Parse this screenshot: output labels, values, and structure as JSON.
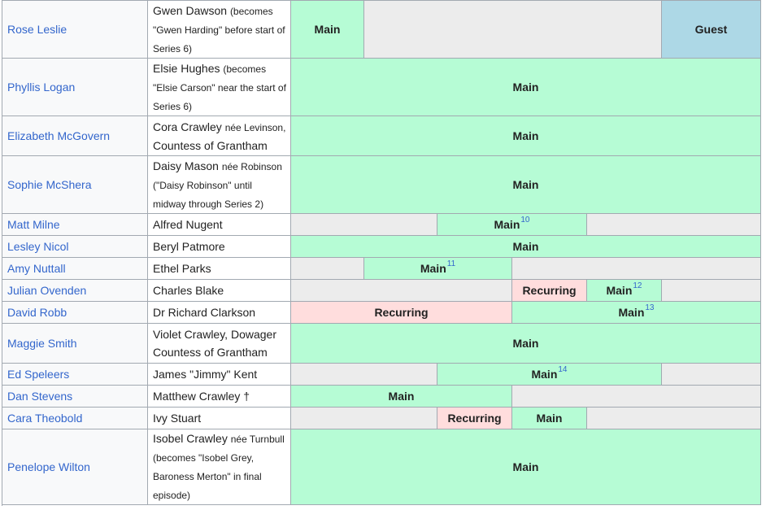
{
  "rows": [
    {
      "actor": "Rose Leslie",
      "role": "Gwen Dawson",
      "role_note": "(becomes \"Gwen Harding\" before start of Series 6)",
      "segs": [
        {
          "t": "main",
          "label": "Main"
        },
        {
          "t": "none",
          "label": ""
        },
        {
          "t": "guest",
          "label": "Guest"
        }
      ]
    },
    {
      "actor": "Phyllis Logan",
      "role": "Elsie Hughes",
      "role_note": "(becomes \"Elsie Carson\" near the start of Series 6)",
      "segs": [
        {
          "t": "main",
          "label": "Main"
        }
      ]
    },
    {
      "actor": "Elizabeth McGovern",
      "role": "Cora Crawley",
      "role_note": "née Levinson,",
      "role_tail": "Countess of Grantham",
      "segs": [
        {
          "t": "main",
          "label": "Main"
        }
      ]
    },
    {
      "actor": "Sophie McShera",
      "role": "Daisy Mason",
      "role_note": "née Robinson (\"Daisy Robinson\" until midway through Series 2)",
      "segs": [
        {
          "t": "main",
          "label": "Main"
        }
      ]
    },
    {
      "actor": "Matt Milne",
      "role": "Alfred Nugent",
      "segs": [
        {
          "t": "none",
          "label": ""
        },
        {
          "t": "main",
          "label": "Main",
          "sup": "10"
        },
        {
          "t": "none",
          "label": ""
        }
      ]
    },
    {
      "actor": "Lesley Nicol",
      "role": "Beryl Patmore",
      "segs": [
        {
          "t": "main",
          "label": "Main"
        }
      ]
    },
    {
      "actor": "Amy Nuttall",
      "role": "Ethel Parks",
      "segs": [
        {
          "t": "none",
          "label": ""
        },
        {
          "t": "main",
          "label": "Main",
          "sup": "11"
        },
        {
          "t": "none",
          "label": ""
        }
      ]
    },
    {
      "actor": "Julian Ovenden",
      "role": "Charles Blake",
      "segs": [
        {
          "t": "none",
          "label": ""
        },
        {
          "t": "rec",
          "label": "Recurring"
        },
        {
          "t": "main",
          "label": "Main",
          "sup": "12"
        },
        {
          "t": "none",
          "label": ""
        }
      ]
    },
    {
      "actor": "David Robb",
      "role": "Dr Richard Clarkson",
      "segs": [
        {
          "t": "rec",
          "label": "Recurring"
        },
        {
          "t": "main",
          "label": "Main",
          "sup": "13"
        }
      ]
    },
    {
      "actor": "Maggie Smith",
      "role": "Violet Crawley, Dowager",
      "role_tail": "Countess of Grantham",
      "segs": [
        {
          "t": "main",
          "label": "Main"
        }
      ]
    },
    {
      "actor": "Ed Speleers",
      "role": "James \"Jimmy\" Kent",
      "segs": [
        {
          "t": "none",
          "label": ""
        },
        {
          "t": "main",
          "label": "Main",
          "sup": "14"
        },
        {
          "t": "none",
          "label": ""
        }
      ]
    },
    {
      "actor": "Dan Stevens",
      "role": "Matthew Crawley †",
      "segs": [
        {
          "t": "main",
          "label": "Main"
        },
        {
          "t": "none",
          "label": ""
        }
      ]
    },
    {
      "actor": "Cara Theobold",
      "role": "Ivy Stuart",
      "segs": [
        {
          "t": "none",
          "label": ""
        },
        {
          "t": "rec",
          "label": "Recurring"
        },
        {
          "t": "main",
          "label": "Main"
        },
        {
          "t": "none",
          "label": ""
        }
      ]
    },
    {
      "actor": "Penelope Wilton",
      "role": "Isobel Crawley",
      "role_note": "née Turnbull (becomes \"Isobel Grey, Baroness Merton\" in final episode)",
      "segs": [
        {
          "t": "main",
          "label": "Main"
        }
      ]
    }
  ],
  "colors": {
    "main": "#b6fcd5",
    "none": "#ececec",
    "recurring": "#ffdddd",
    "guest": "#add8e6",
    "link": "#3366cc"
  }
}
